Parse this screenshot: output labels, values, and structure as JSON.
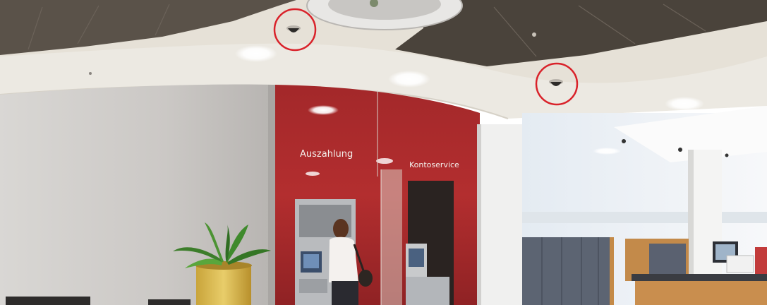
{
  "signs": {
    "withdrawal": "Auszahlung",
    "account_service": "Kontoservice"
  },
  "highlight_color": "#d9222a",
  "palette": {
    "ceiling": "#e9e5dc",
    "ceiling_panel": "#4b443c",
    "stone_wall": "#cdcac6",
    "red_wall": "#a5282b",
    "floor_area": "#f2f2f0"
  },
  "highlighted_objects": [
    "dome-camera",
    "dome-camera"
  ]
}
